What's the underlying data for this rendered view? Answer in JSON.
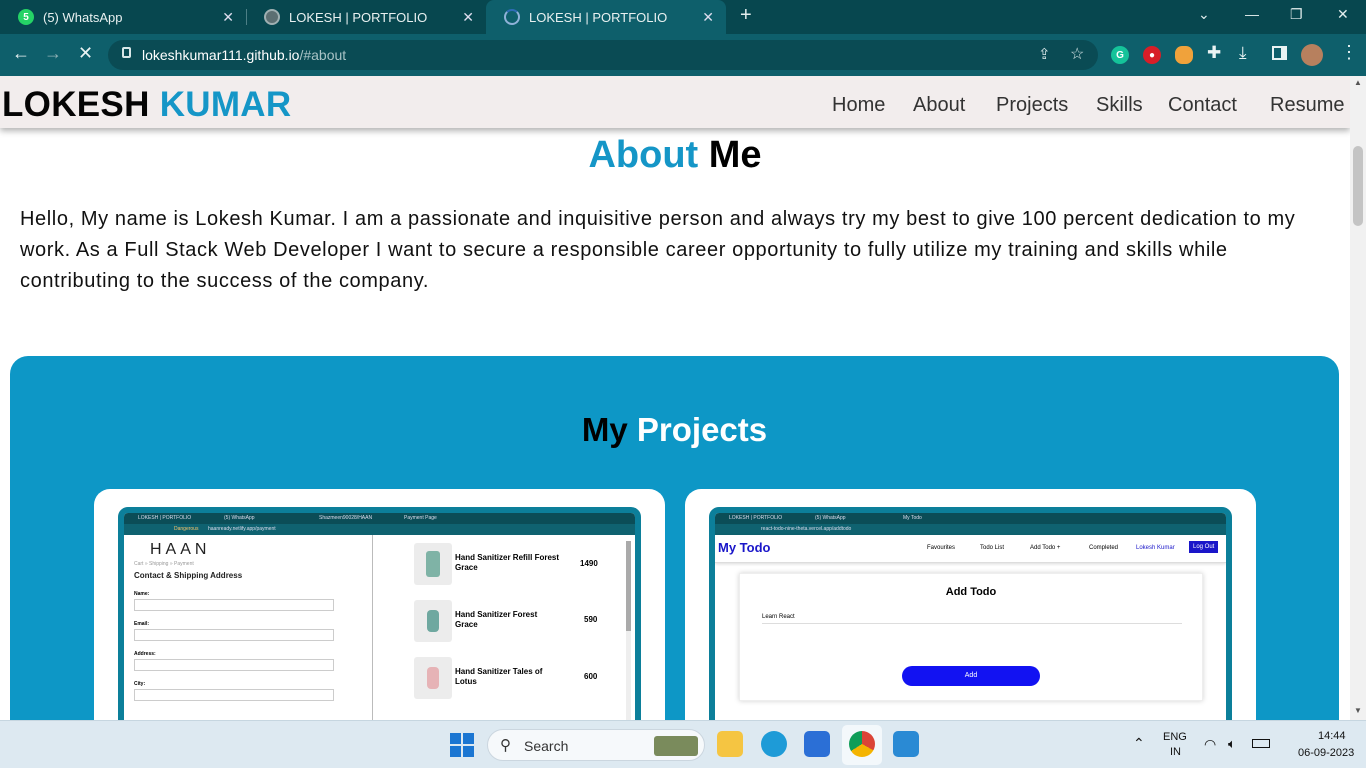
{
  "browser": {
    "tabs": [
      {
        "title": "(5) WhatsApp",
        "icon": "whatsapp-icon",
        "badge": "5"
      },
      {
        "title": "LOKESH | PORTFOLIO",
        "icon": "globe-icon"
      },
      {
        "title": "LOKESH | PORTFOLIO",
        "icon": "loading-icon",
        "active": true
      }
    ],
    "url_host": "lokeshkumar111.github.io",
    "url_path": "/#about"
  },
  "site": {
    "brand_first": "LOKESH",
    "brand_second": "KUMAR",
    "nav": [
      "Home",
      "About",
      "Projects",
      "Skills",
      "Contact",
      "Resume"
    ],
    "about_heading_a": "About",
    "about_heading_b": "Me",
    "about_text": "Hello, My name is Lokesh Kumar. I am a passionate and inquisitive person and always try my best to give 100 percent dedication to my work. As a Full Stack Web Developer I want to secure a responsible career opportunity to fully utilize my training and skills while contributing to the success of the company.",
    "projects_heading_a": "My",
    "projects_heading_b": "Projects"
  },
  "project1": {
    "tabs": [
      "LOKESH | PORTFOLIO",
      "(5) WhatsApp",
      "Shazmeen90028/HAAN",
      "Payment Page"
    ],
    "url": "haanready.netlify.app/payment",
    "url_warning": "Dangerous",
    "logo": "HAAN",
    "breadcrumb": "Cart » Shipping » Payment",
    "form_title": "Contact & Shipping Address",
    "fields": [
      "Name:",
      "Email:",
      "Address:",
      "City:"
    ],
    "products": [
      {
        "name": "Hand Sanitizer Refill Forest Grace",
        "price": "1490",
        "color": "#7fb3a6"
      },
      {
        "name": "Hand Sanitizer Forest Grace",
        "price": "590",
        "color": "#6fa8a0"
      },
      {
        "name": "Hand Sanitizer Tales of Lotus",
        "price": "600",
        "color": "#e6b3b6"
      }
    ]
  },
  "project2": {
    "tabs": [
      "LOKESH | PORTFOLIO",
      "(5) WhatsApp",
      "My Todo"
    ],
    "url": "react-todo-nine-theta.vercel.app/addtodo",
    "brand": "My Todo",
    "nav": [
      "Favourites",
      "Todo List",
      "Add Todo +",
      "Completed"
    ],
    "user": "Lokesh Kumar",
    "logout": "Log Out",
    "card_title": "Add Todo",
    "input_value": "Learn React",
    "add_button": "Add"
  },
  "taskbar": {
    "search_label": "Search",
    "lang": "ENG",
    "region": "IN",
    "time": "14:44",
    "date": "06-09-2023"
  }
}
